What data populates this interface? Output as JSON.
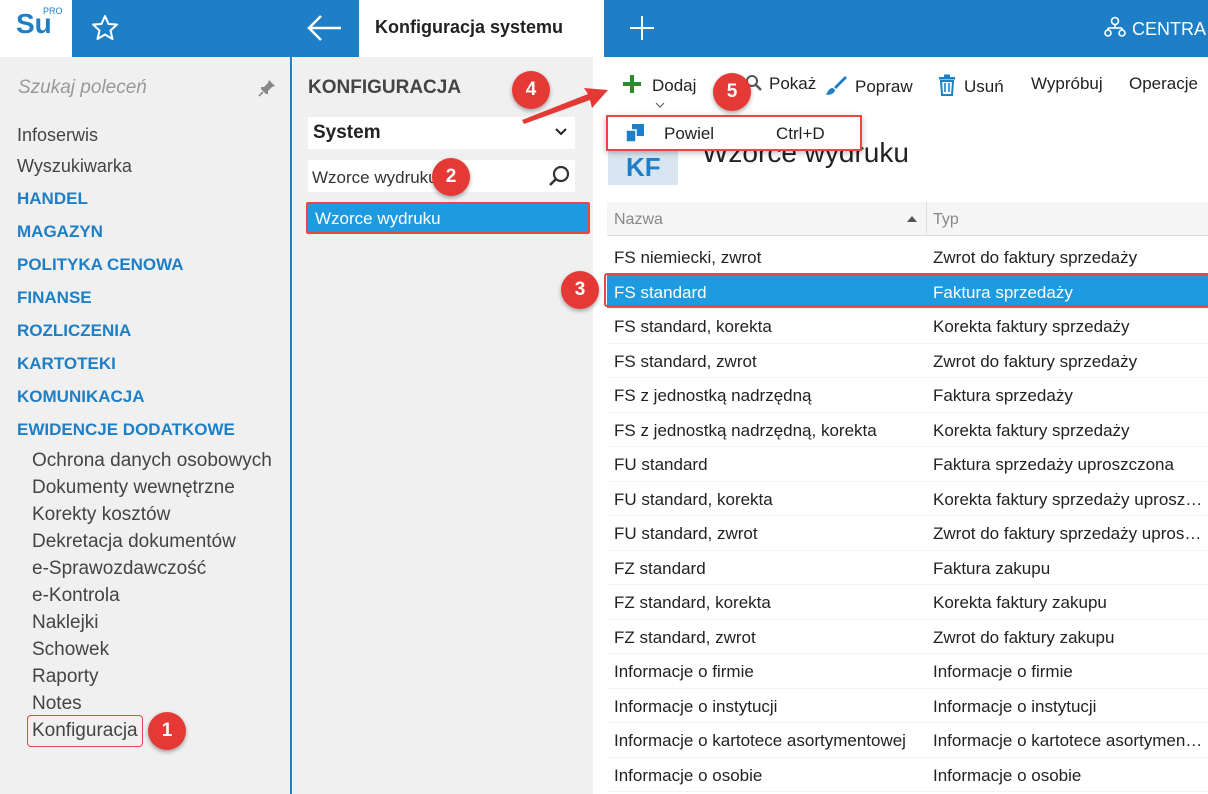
{
  "topbar": {
    "logo_text": "Su",
    "logo_sup": "PRO",
    "active_tab": "Konfiguracja systemu",
    "right_label": "CENTRA",
    "colors": {
      "bar": "#1e7fc6"
    }
  },
  "sidebar": {
    "search_placeholder": "Szukaj poleceń",
    "items": [
      {
        "label": "Infoserwis",
        "type": "plain"
      },
      {
        "label": "Wyszukiwarka",
        "type": "plain"
      },
      {
        "label": "HANDEL",
        "type": "section"
      },
      {
        "label": "MAGAZYN",
        "type": "section"
      },
      {
        "label": "POLITYKA CENOWA",
        "type": "section"
      },
      {
        "label": "FINANSE",
        "type": "section"
      },
      {
        "label": "ROZLICZENIA",
        "type": "section"
      },
      {
        "label": "KARTOTEKI",
        "type": "section"
      },
      {
        "label": "KOMUNIKACJA",
        "type": "section"
      },
      {
        "label": "EWIDENCJE DODATKOWE",
        "type": "section"
      }
    ],
    "subitems": [
      "Ochrona danych osobowych",
      "Dokumenty wewnętrzne",
      "Korekty kosztów",
      "Dekretacja dokumentów",
      "e-Sprawozdawczość",
      "e-Kontrola",
      "Naklejki",
      "Schowek",
      "Raporty",
      "Notes",
      "Konfiguracja"
    ]
  },
  "middle": {
    "title": "KONFIGURACJA",
    "select_value": "System",
    "search_value": "Wzorce wydruku",
    "list_item": "Wzorce wydruku"
  },
  "toolbar": {
    "add": "Dodaj",
    "show": "Pokaż",
    "edit": "Popraw",
    "delete": "Usuń",
    "try": "Wypróbuj",
    "operations": "Operacje"
  },
  "dropdown": {
    "label": "Powiel",
    "shortcut": "Ctrl+D"
  },
  "content": {
    "icon_text": "KF",
    "title": "Wzorce wydruku"
  },
  "table": {
    "headers": [
      "Nazwa",
      "Typ"
    ],
    "rows": [
      [
        "FS niemiecki, zwrot",
        "Zwrot do faktury sprzedaży"
      ],
      [
        "FS standard",
        "Faktura sprzedaży"
      ],
      [
        "FS standard, korekta",
        "Korekta faktury sprzedaży"
      ],
      [
        "FS standard, zwrot",
        "Zwrot do faktury sprzedaży"
      ],
      [
        "FS z jednostką nadrzędną",
        "Faktura sprzedaży"
      ],
      [
        "FS z jednostką nadrzędną, korekta",
        "Korekta faktury sprzedaży"
      ],
      [
        "FU standard",
        "Faktura sprzedaży uproszczona"
      ],
      [
        "FU standard, korekta",
        "Korekta faktury sprzedaży uproszczonej"
      ],
      [
        "FU standard, zwrot",
        "Zwrot do faktury sprzedaży uproszczonej"
      ],
      [
        "FZ standard",
        "Faktura zakupu"
      ],
      [
        "FZ standard, korekta",
        "Korekta faktury zakupu"
      ],
      [
        "FZ standard, zwrot",
        "Zwrot do faktury zakupu"
      ],
      [
        "Informacje o firmie",
        "Informacje o firmie"
      ],
      [
        "Informacje o instytucji",
        "Informacje o instytucji"
      ],
      [
        "Informacje o kartotece asortymentowej",
        "Informacje o kartotece asortymentowej"
      ],
      [
        "Informacje o osobie",
        "Informacje o osobie"
      ]
    ],
    "selected_index": 1
  },
  "badges": [
    "1",
    "2",
    "3",
    "4",
    "5"
  ],
  "icons": {
    "star": "star-icon",
    "back": "arrow-left-icon",
    "new_tab": "plus-icon",
    "org": "org-chart-icon",
    "pin": "pin-icon",
    "search": "search-icon",
    "chevron": "chevron-down-icon",
    "add": "plus-icon",
    "show": "magnifier-icon",
    "edit": "brush-icon",
    "delete": "trash-icon",
    "duplicate": "duplicate-icon"
  },
  "colors": {
    "accent": "#1e7fc6",
    "selection": "#1e9ae0",
    "annotation": "#e53935"
  }
}
